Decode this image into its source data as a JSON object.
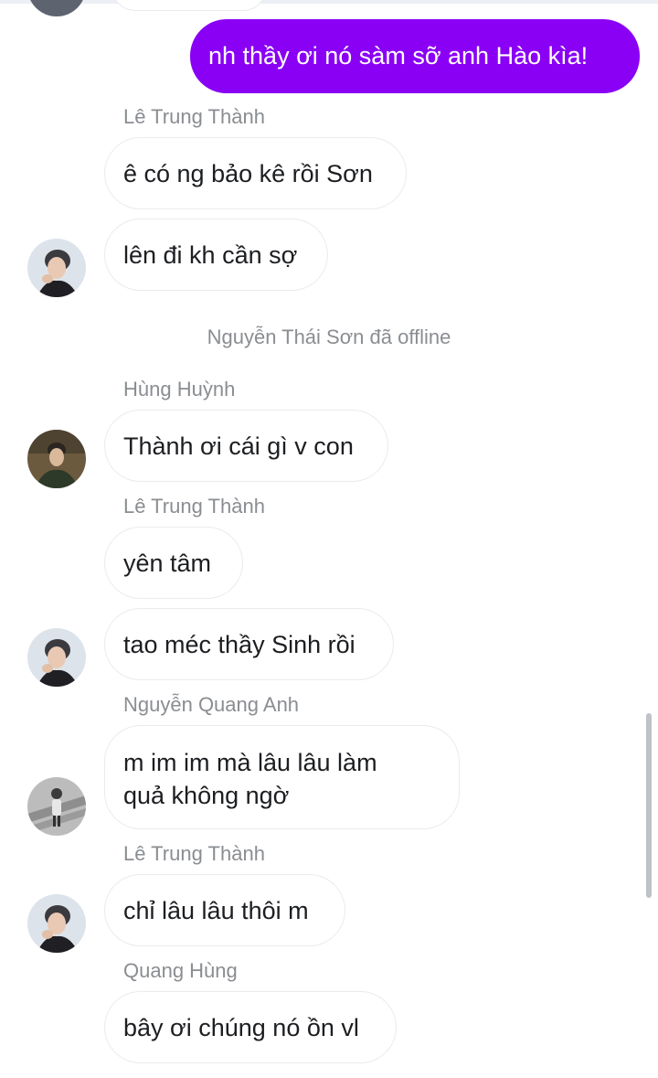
{
  "colors": {
    "outgoing_bubble": "#8a00f5",
    "incoming_bubble_border": "#e9ebee",
    "meta_text": "#8a8d91"
  },
  "messages": {
    "m0": {
      "text": "nh thầy ơi nó sàm sỡ anh Hào kìa!"
    },
    "m1": {
      "sender": "Lê Trung Thành",
      "text": "ê có ng bảo kê rồi Sơn"
    },
    "m2": {
      "text": "lên đi kh cần sợ"
    },
    "sys": {
      "text": "Nguyễn Thái Sơn đã offline"
    },
    "m3": {
      "sender": "Hùng Huỳnh",
      "text": "Thành ơi cái gì v con"
    },
    "m4": {
      "sender": "Lê Trung Thành",
      "text": "yên tâm"
    },
    "m5": {
      "text": "tao méc thầy Sinh rồi"
    },
    "m6": {
      "sender": "Nguyễn Quang Anh",
      "line1": "m im im mà lâu lâu làm",
      "line2": "quả không ngờ"
    },
    "m7": {
      "sender": "Lê Trung Thành",
      "text": "chỉ lâu lâu thôi m"
    },
    "m8": {
      "sender": "Quang Hùng",
      "text": "bây ơi chúng nó ồn vl"
    }
  }
}
